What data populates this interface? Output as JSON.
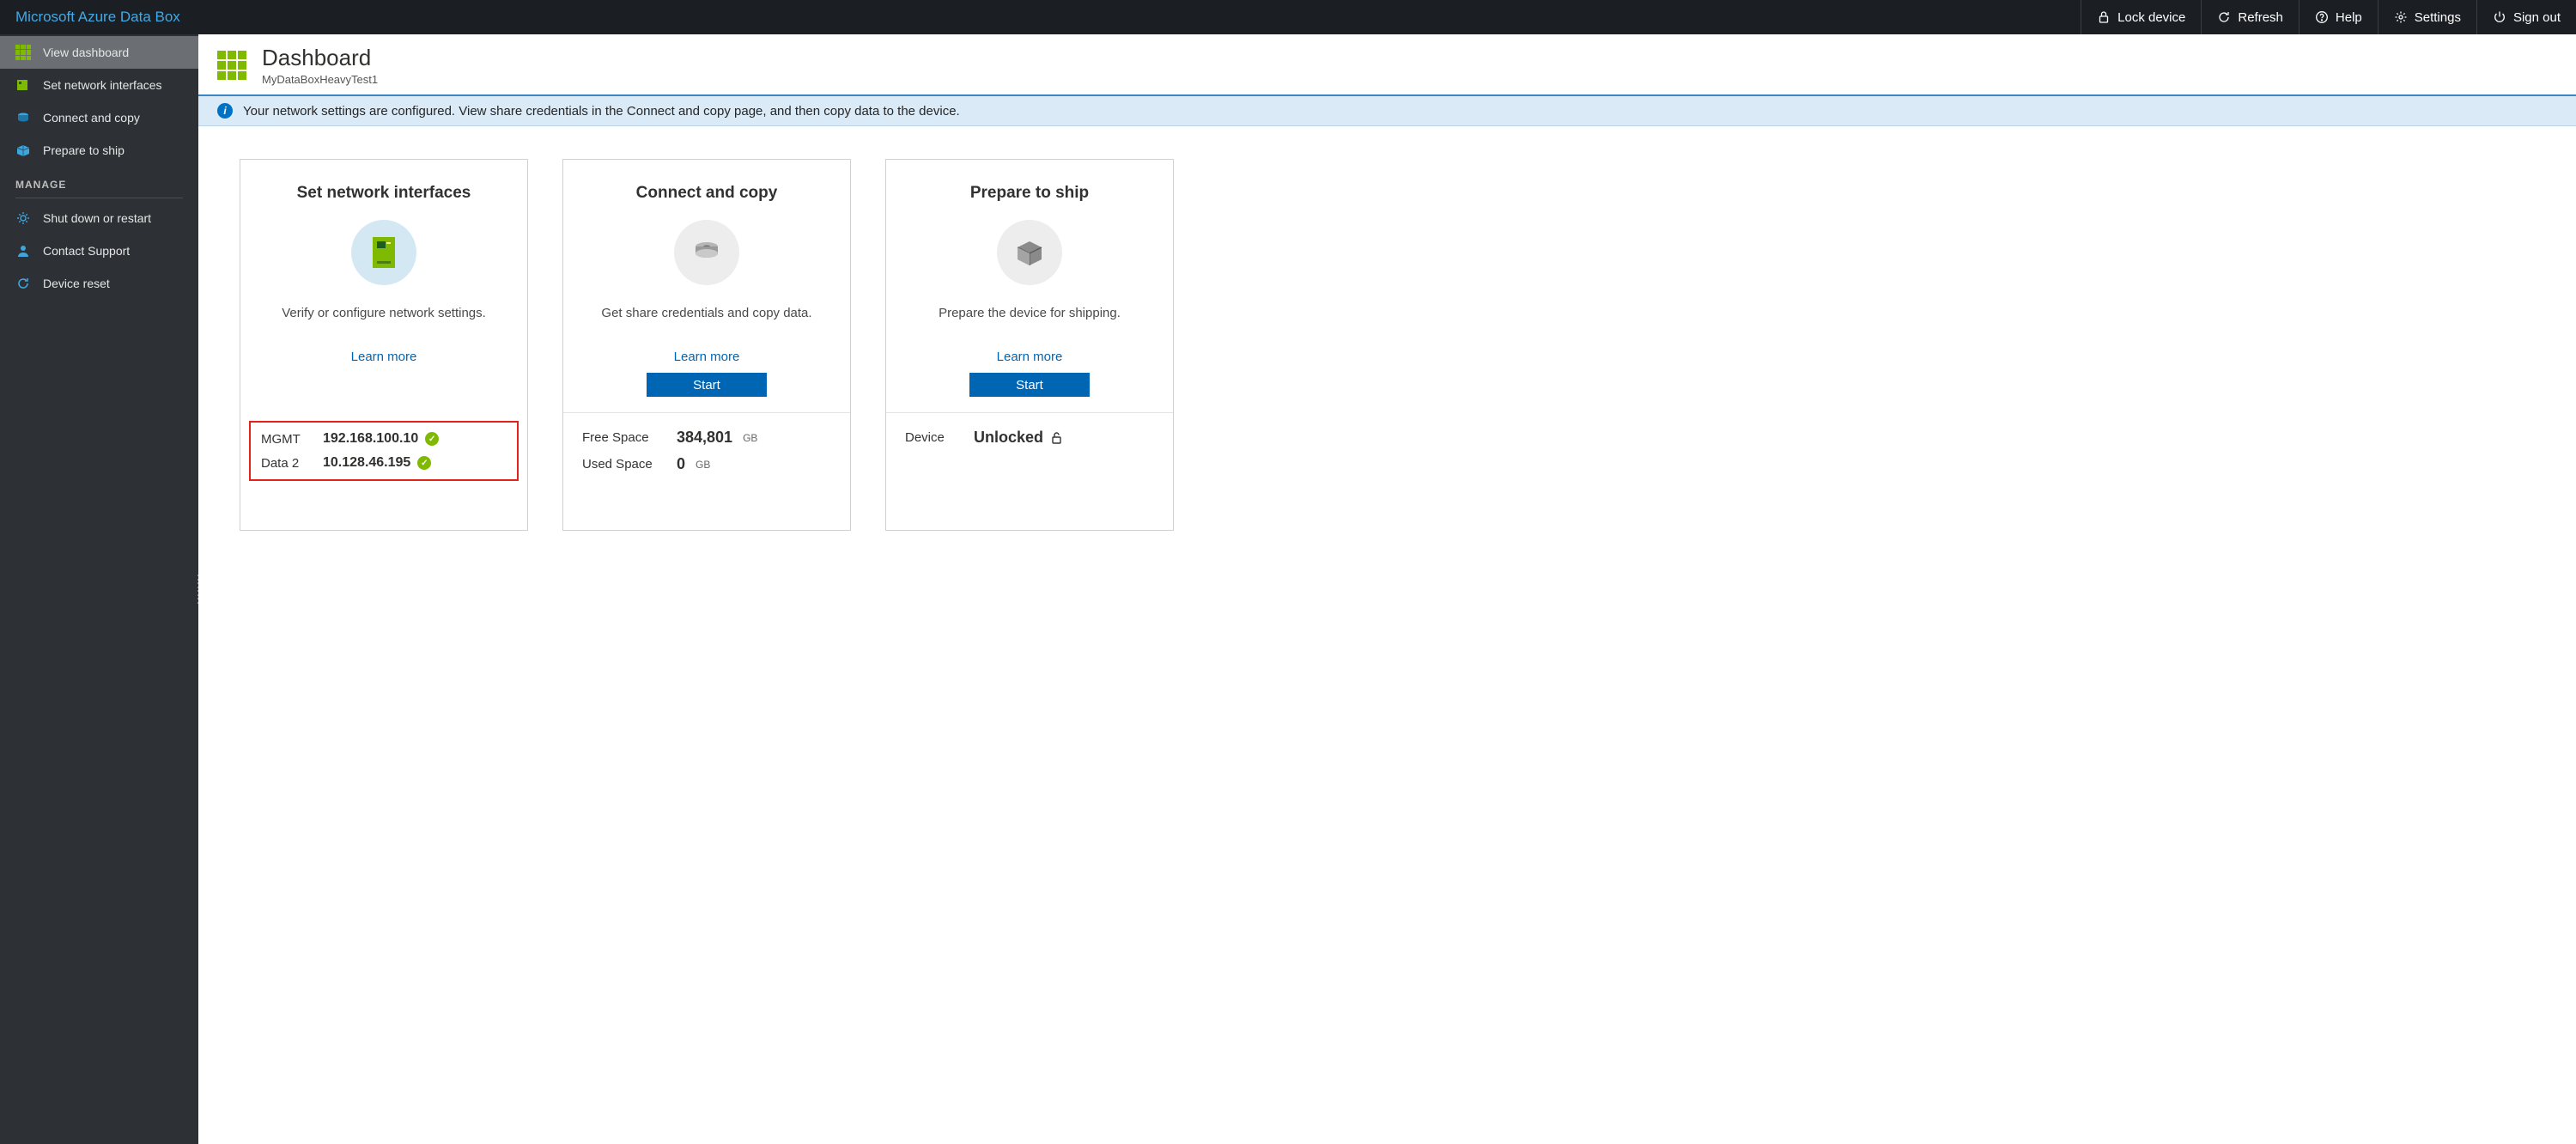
{
  "brand": "Microsoft Azure Data Box",
  "topbar": {
    "lock": "Lock device",
    "refresh": "Refresh",
    "help": "Help",
    "settings": "Settings",
    "signout": "Sign out"
  },
  "sidebar": {
    "view_dashboard": "View dashboard",
    "set_network": "Set network interfaces",
    "connect_copy": "Connect and copy",
    "prepare_ship": "Prepare to ship",
    "section_manage": "MANAGE",
    "shutdown": "Shut down or restart",
    "contact": "Contact Support",
    "reset": "Device reset"
  },
  "header": {
    "title": "Dashboard",
    "subtitle": "MyDataBoxHeavyTest1"
  },
  "banner": "Your network settings are configured. View share credentials in the Connect and copy page, and then copy data to the device.",
  "cards": {
    "network": {
      "title": "Set network interfaces",
      "desc": "Verify or configure network settings.",
      "learn": "Learn more",
      "rows": [
        {
          "label": "MGMT",
          "value": "192.168.100.10"
        },
        {
          "label": "Data 2",
          "value": "10.128.46.195"
        }
      ]
    },
    "connect": {
      "title": "Connect and copy",
      "desc": "Get share credentials and copy data.",
      "learn": "Learn more",
      "start": "Start",
      "free_label": "Free Space",
      "free_value": "384,801",
      "free_unit": "GB",
      "used_label": "Used Space",
      "used_value": "0",
      "used_unit": "GB"
    },
    "ship": {
      "title": "Prepare to ship",
      "desc": "Prepare the device for shipping.",
      "learn": "Learn more",
      "start": "Start",
      "device_label": "Device",
      "device_value": "Unlocked"
    }
  }
}
